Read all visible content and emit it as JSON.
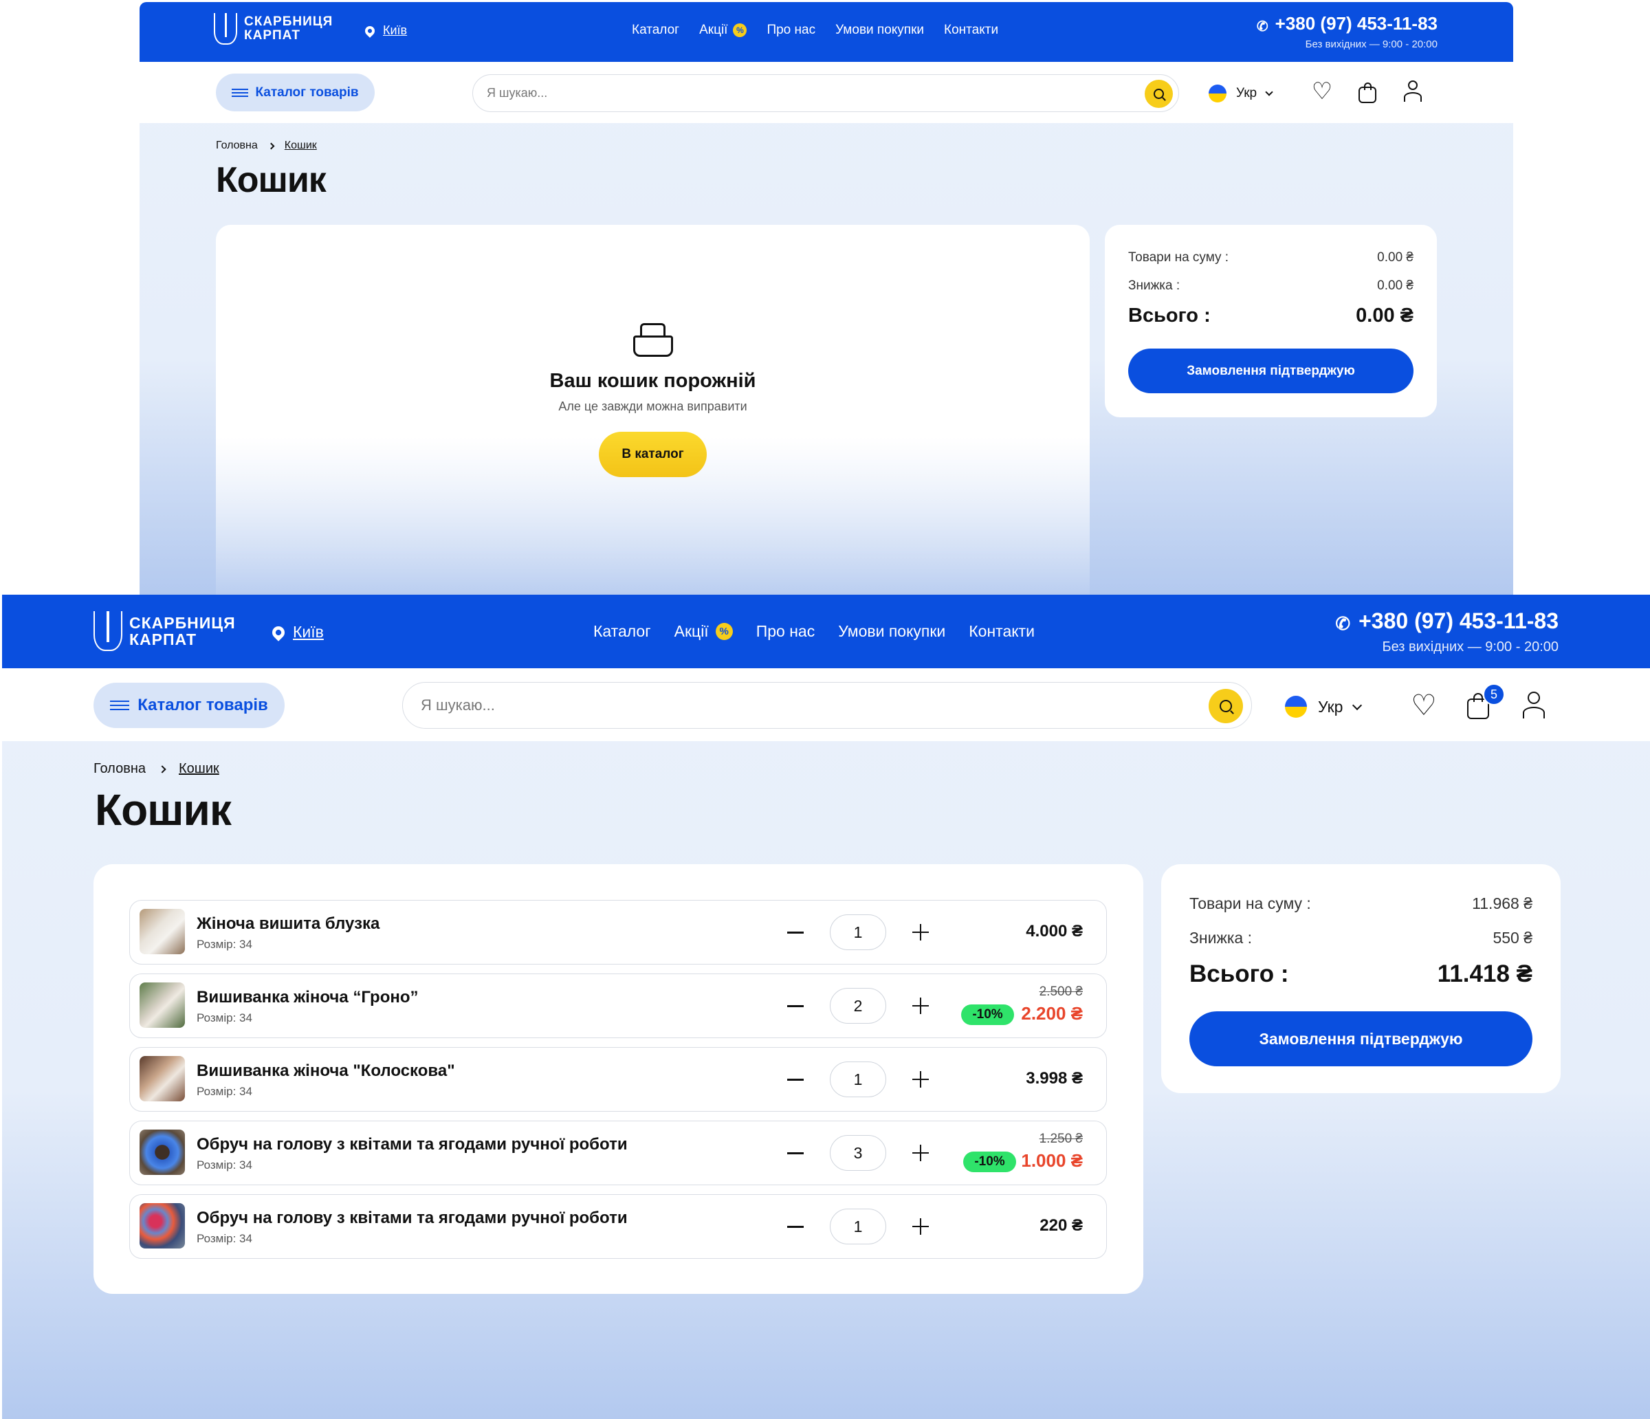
{
  "brand": {
    "line1": "СКАРБНИЦЯ",
    "line2": "КАРПАТ"
  },
  "city": "Київ",
  "nav": [
    "Каталог",
    "Акції",
    "Про нас",
    "Умови покупки",
    "Контакти"
  ],
  "promo_badge": "%",
  "phone": {
    "number": "+380 (97) 453-11-83",
    "hours": "Без вихідних — 9:00 - 20:00"
  },
  "catalog_button": "Каталог товарів",
  "search": {
    "placeholder": "Я шукаю..."
  },
  "language": "Укр",
  "breadcrumb": {
    "home": "Головна",
    "current": "Кошик"
  },
  "page_title": "Кошик",
  "colors": {
    "primary": "#0a4fdf",
    "accent": "#f7cd1a",
    "discount": "#2fe36a",
    "sale_price": "#e8452b"
  },
  "empty_cart": {
    "icon": "basket-icon",
    "title": "Ваш кошик порожній",
    "subtitle": "Але це завжди можна виправити",
    "button": "В каталог",
    "summary": {
      "subtotal_label": "Товари на суму :",
      "subtotal": "0.00 ₴",
      "discount_label": "Знижка :",
      "discount": "0.00 ₴",
      "total_label": "Всього :",
      "total": "0.00 ₴",
      "confirm": "Замовлення підтверджую"
    }
  },
  "filled_cart": {
    "cart_count": "5",
    "items": [
      {
        "name": "Жіноча вишита блузка",
        "size": "Розмір: 34",
        "qty": "1",
        "price": "4.000 ₴"
      },
      {
        "name": "Вишиванка жіноча “Гроно”",
        "size": "Розмір: 34",
        "qty": "2",
        "old_price": "2.500 ₴",
        "discount": "-10%",
        "price": "2.200 ₴"
      },
      {
        "name": "Вишиванка жіноча \"Колоскова\"",
        "size": "Розмір: 34",
        "qty": "1",
        "price": "3.998 ₴"
      },
      {
        "name": "Обруч на голову з квітами та ягодами ручної роботи",
        "size": "Розмір: 34",
        "qty": "3",
        "old_price": "1.250 ₴",
        "discount": "-10%",
        "price": "1.000 ₴"
      },
      {
        "name": "Обруч на голову з квітами та ягодами ручної роботи",
        "size": "Розмір: 34",
        "qty": "1",
        "price": "220 ₴"
      }
    ],
    "summary": {
      "subtotal_label": "Товари на суму :",
      "subtotal": "11.968 ₴",
      "discount_label": "Знижка :",
      "discount": "550 ₴",
      "total_label": "Всього :",
      "total": "11.418 ₴",
      "confirm": "Замовлення підтверджую"
    }
  }
}
